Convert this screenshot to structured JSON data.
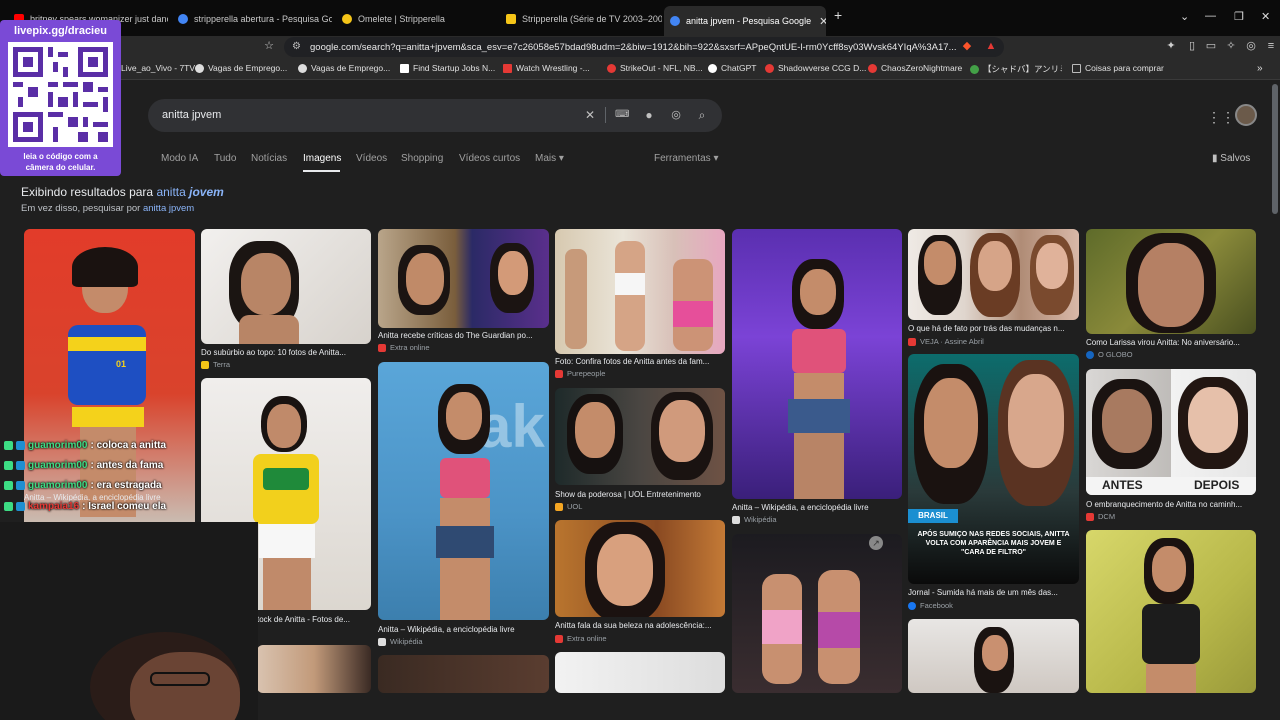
{
  "tabs": [
    {
      "title": "britney spears womanizer just dance",
      "favicon_color": "#ff0000"
    },
    {
      "title": "stripperella abertura - Pesquisa Goog",
      "favicon_color": "#4285f4"
    },
    {
      "title": "Omelete | Stripperella",
      "favicon_color": "#f5c518"
    },
    {
      "title": "Stripperella (Série de TV 2003–2004)",
      "favicon_color": "#f5c518"
    },
    {
      "title": "anitta jpvem - Pesquisa Google",
      "favicon_color": "#4285f4",
      "active": true
    }
  ],
  "new_tab_label": "+",
  "window_controls": {
    "dropdown": "⌄",
    "minimize": "—",
    "maximize": "❐",
    "close": "✕"
  },
  "url": "google.com/search?q=anitta+jpvem&sca_esv=e7c26058e57bdad98udm=2&biw=1912&bih=922&sxsrf=APpeQntUE-l-rm0Ycff8sy03Wvsk64YIqA%3A17...",
  "bookmarks": [
    {
      "label": "Live_ao_Vivo - 7TV",
      "color": "#29a3e8"
    },
    {
      "label": "Vagas de Emprego...",
      "color": "#dddddd"
    },
    {
      "label": "Vagas de Emprego...",
      "color": "#dddddd"
    },
    {
      "label": "Find Startup Jobs N...",
      "color": "#ffffff"
    },
    {
      "label": "Watch Wrestling -...",
      "color": "#e53935"
    },
    {
      "label": "StrikeOut - NFL, NB...",
      "color": "#e53935"
    },
    {
      "label": "ChatGPT",
      "color": "#ffffff"
    },
    {
      "label": "Shadowverse CCG D...",
      "color": "#e53935"
    },
    {
      "label": "ChaosZeroNightmare",
      "color": "#e53935"
    },
    {
      "label": "【シャドバ】アンリミテッ...",
      "color": "#43a047"
    },
    {
      "label": "Coisas para comprar",
      "color": "#bbbbbb"
    }
  ],
  "search": {
    "query": "anitta jpvem"
  },
  "nav_tabs": [
    "Modo IA",
    "Tudo",
    "Notícias",
    "Imagens",
    "Vídeos",
    "Shopping",
    "Vídeos curtos",
    "Mais ▾"
  ],
  "tools_label": "Ferramentas ▾",
  "saved_label": "Salvos",
  "showing": {
    "prefix": "Exibindo resultados para",
    "term_plain": "anitta",
    "term_bold": "jovem"
  },
  "instead": {
    "prefix": "Em vez disso, pesquisar por",
    "term": "anitta jpvem"
  },
  "results": [
    {
      "caption": "Do subúrbio ao topo: 10 fotos de Anitta...",
      "source": "Terra",
      "src_color": "#f5c518"
    },
    {
      "caption": "Anitta recebe críticas do The Guardian po...",
      "source": "Extra online",
      "src_color": "#e53935"
    },
    {
      "caption": "Foto: Confira fotos de Anitta antes da fam...",
      "source": "Purepeople",
      "src_color": "#e53935"
    },
    {
      "caption": "O que há de fato por trás das mudanças n...",
      "source": "VEJA · Assine Abril",
      "src_color": "#e53935"
    },
    {
      "caption": "Como Larissa virou Anitta: No aniversário...",
      "source": "O GLOBO",
      "src_color": "#1565c0"
    },
    {
      "caption": "Show da poderosa | UOL Entretenimento",
      "source": "UOL",
      "src_color": "#f5a623"
    },
    {
      "caption": "Anitta – Wikipédia, a enciclopédia livre",
      "source": "Wikipédia",
      "src_color": "#dddddd"
    },
    {
      "caption": "O embranquecimento de Anitta no caminh...",
      "source": "DCM",
      "src_color": "#e53935"
    },
    {
      "caption": "Anitta – Wikipédia, a enciclopédia livre",
      "source": "Wikipédia",
      "src_color": "#dddddd"
    },
    {
      "caption": "Anitta fala da sua beleza na adolescência:...",
      "source": "Extra online",
      "src_color": "#e53935"
    },
    {
      "caption": "Jornal - Sumida há mais de um mês das...",
      "source": "Facebook",
      "src_color": "#1877f2"
    },
    {
      "caption": "tock de Anitta - Fotos de..."
    },
    {
      "caption": "Anitta – Wikipédia, a enciclopédia livre"
    }
  ],
  "image_overlays": {
    "antes": "ANTES",
    "depois": "DEPOIS",
    "brasil": "BRASIL",
    "jornal_text": "APÓS SUMIÇO NAS REDES SOCIAIS, ANITTA VOLTA COM APARÊNCIA MAIS JOVEM E \"CARA DE FILTRO\"",
    "jersey_number": "01"
  },
  "qr": {
    "url": "livepix.gg/dracieu",
    "caption_line1": "leia o código com a",
    "caption_line2": "câmera do celular."
  },
  "chat": [
    {
      "user": "guamorim00",
      "message": ": coloca a anitta"
    },
    {
      "user": "guamorim00",
      "message": ": antes da fama"
    },
    {
      "user": "guamorim00",
      "message": ": era estragada"
    },
    {
      "user": "kampaia16",
      "message": ": Israel comeu ela"
    }
  ]
}
